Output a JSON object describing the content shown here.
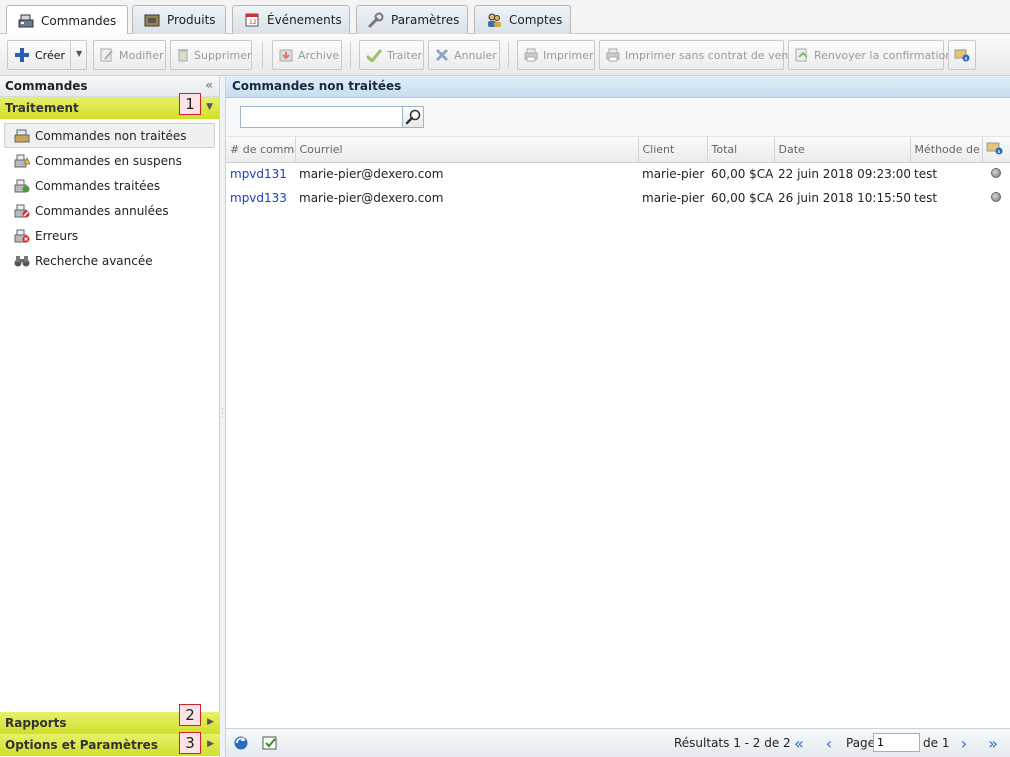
{
  "tabs": [
    {
      "label": "Commandes",
      "icon": "cash-register-icon",
      "active": true
    },
    {
      "label": "Produits",
      "icon": "box-icon",
      "active": false
    },
    {
      "label": "Événements",
      "icon": "calendar-icon",
      "active": false
    },
    {
      "label": "Paramètres",
      "icon": "wrench-icon",
      "active": false
    },
    {
      "label": "Comptes",
      "icon": "users-icon",
      "active": false
    }
  ],
  "toolbar": {
    "create": "Créer",
    "edit": "Modifier",
    "delete": "Supprimer",
    "archive": "Archive",
    "process": "Traiter",
    "cancel": "Annuler",
    "print": "Imprimer",
    "print_no_contract": "Imprimer sans contrat de vente",
    "resend": "Renvoyer la confirmation"
  },
  "sidebar": {
    "title": "Commandes",
    "section_processing": "Traitement",
    "items": [
      {
        "label": "Commandes non traitées",
        "icon": "orders-pending-icon",
        "selected": true
      },
      {
        "label": "Commandes en suspens",
        "icon": "orders-hold-icon",
        "selected": false
      },
      {
        "label": "Commandes traitées",
        "icon": "orders-done-icon",
        "selected": false
      },
      {
        "label": "Commandes annulées",
        "icon": "orders-cancelled-icon",
        "selected": false
      },
      {
        "label": "Erreurs",
        "icon": "errors-icon",
        "selected": false
      },
      {
        "label": "Recherche avancée",
        "icon": "binoculars-icon",
        "selected": false
      }
    ],
    "section_reports": "Rapports",
    "section_options": "Options et Paramètres",
    "badges": [
      "1",
      "2",
      "3"
    ]
  },
  "main": {
    "title": "Commandes non traitées",
    "search_value": "",
    "columns": [
      "# de comma",
      "Courriel",
      "Client",
      "Total",
      "Date",
      "Méthode de"
    ],
    "rows": [
      {
        "id": "mpvd131",
        "email": "marie-pier@dexero.com",
        "client": "marie-pier",
        "total": "60,00 $CA",
        "date": "22 juin 2018 09:23:00",
        "method": "test"
      },
      {
        "id": "mpvd133",
        "email": "marie-pier@dexero.com",
        "client": "marie-pier",
        "total": "60,00 $CA",
        "date": "26 juin 2018 10:15:50",
        "method": "test"
      }
    ]
  },
  "footer": {
    "results": "Résultats 1 - 2 de 2",
    "page_label": "Page",
    "page_value": "1",
    "of_label": "de 1"
  }
}
